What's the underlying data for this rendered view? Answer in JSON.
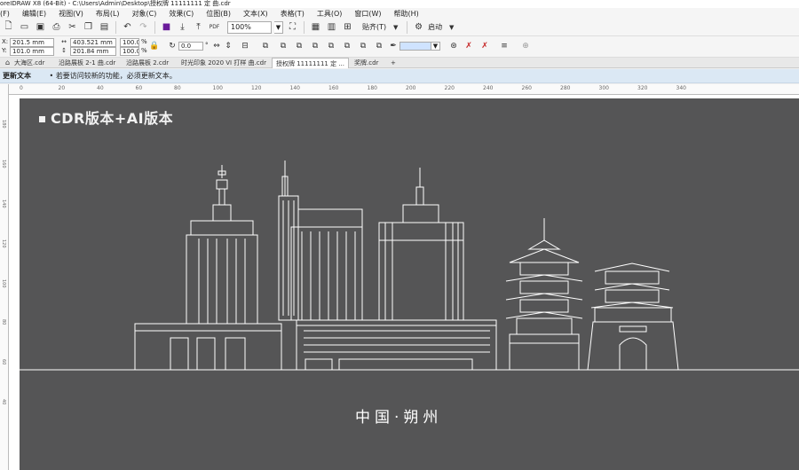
{
  "window": {
    "title": "oreIDRAW X8 (64-Bit) - C:\\Users\\Admin\\Desktop\\授权牌 11111111 定 曲.cdr"
  },
  "menu": {
    "items": [
      "(F)",
      "编辑(E)",
      "视图(V)",
      "布局(L)",
      "对象(C)",
      "效果(C)",
      "位图(B)",
      "文本(X)",
      "表格(T)",
      "工具(O)",
      "窗口(W)",
      "帮助(H)"
    ]
  },
  "toolbar": {
    "zoom": "100%",
    "snap_label": "贴齐(T)",
    "launch_label": "启动",
    "pdf_label": "PDF"
  },
  "property_bar": {
    "x_label": "X:",
    "x_value": "201.5 mm",
    "y_label": "Y:",
    "y_value": "101.0 mm",
    "w_value": "403.521 mm",
    "h_value": "201.84 mm",
    "scale_x": "100.0",
    "scale_y": "100.0",
    "pct": "%",
    "rotation": "0.0",
    "degree": "°"
  },
  "tabs": [
    {
      "label": "大海区.cdr",
      "active": false
    },
    {
      "label": "沿路展板 2-1 曲.cdr",
      "active": false
    },
    {
      "label": "沿路展板 2.cdr",
      "active": false
    },
    {
      "label": "时光印象 2020 VI 打样 曲.cdr",
      "active": false
    },
    {
      "label": "授权牌 11111111 定 ...",
      "active": true
    },
    {
      "label": "奖牌.cdr",
      "active": false
    }
  ],
  "hint": {
    "title": "更新文本",
    "message": "若要访问较新的功能，必须更新文本。"
  },
  "ruler": {
    "top_ticks": [
      "0",
      "20",
      "40",
      "60",
      "80",
      "100",
      "120",
      "140",
      "160",
      "180",
      "200",
      "220",
      "240",
      "260",
      "280",
      "300",
      "320",
      "340"
    ],
    "left_ticks": [
      "180",
      "160",
      "140",
      "120",
      "100",
      "80",
      "60",
      "40"
    ]
  },
  "artwork": {
    "label": "CDR版本+AI版本",
    "city_title": "中国·朔州"
  },
  "colors": {
    "canvas_bg": "#555556",
    "line_art": "#ffffff",
    "hint_bg": "#dbe8f4"
  }
}
